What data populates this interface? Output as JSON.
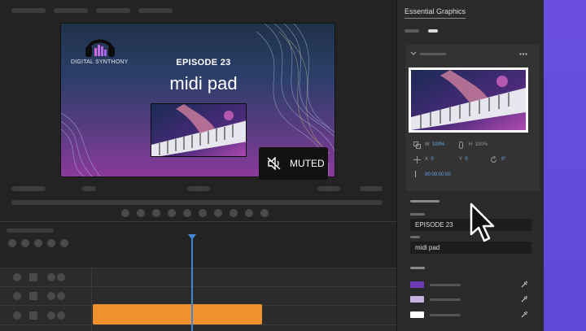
{
  "preview": {
    "logo_text": "DIGITAL SYNTHONY",
    "episode": "EPISODE 23",
    "title": "midi pad",
    "muted_label": "MUTED"
  },
  "panel": {
    "title": "Essential Graphics",
    "transform": {
      "w_label": "W",
      "w_value": "100%",
      "h_label": "H",
      "h_value": "100%",
      "x_label": "X",
      "x_value": "0",
      "y_label": "Y",
      "y_value": "0",
      "rotation_value": "0°",
      "time_value": "00:00:00:00"
    },
    "text_fields": [
      "EPISODE 23",
      "midi pad"
    ],
    "swatches": [
      "#6c3bb5",
      "#c7b4e3",
      "#ffffff"
    ]
  },
  "colors": {
    "accent_blue": "#3f86d6",
    "clip_orange": "#f0902f",
    "side_strip": "#6a4fe0"
  },
  "icons": [
    "headphones-icon",
    "speaker-muted-icon",
    "link-icon",
    "move-icon",
    "rotate-icon",
    "eyedropper-icon",
    "chevron-down-icon",
    "more-icon",
    "pointer-cursor-icon"
  ]
}
